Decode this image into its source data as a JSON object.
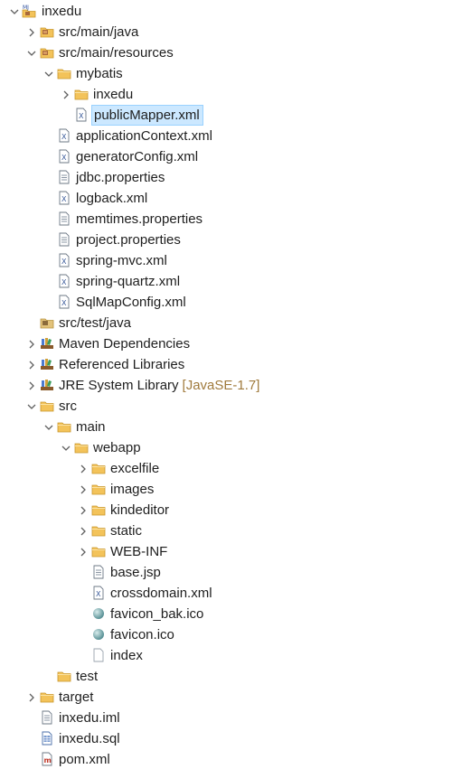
{
  "project_explorer": {
    "items": [
      {
        "label": "inxedu",
        "icon": "maven-project-icon",
        "state": "expanded",
        "level": 0
      },
      {
        "label": "src/main/java",
        "icon": "source-folder-icon",
        "state": "collapsed",
        "level": 1
      },
      {
        "label": "src/main/resources",
        "icon": "source-folder-icon",
        "state": "expanded",
        "level": 1
      },
      {
        "label": "mybatis",
        "icon": "folder-icon",
        "state": "expanded",
        "level": 2
      },
      {
        "label": "inxedu",
        "icon": "folder-icon",
        "state": "collapsed",
        "level": 3
      },
      {
        "label": "publicMapper.xml",
        "icon": "xml-file-icon",
        "state": "leaf",
        "level": 3,
        "selected": true
      },
      {
        "label": "applicationContext.xml",
        "icon": "xml-file-icon",
        "state": "leaf",
        "level": 2
      },
      {
        "label": "generatorConfig.xml",
        "icon": "xml-file-icon",
        "state": "leaf",
        "level": 2
      },
      {
        "label": "jdbc.properties",
        "icon": "text-file-icon",
        "state": "leaf",
        "level": 2
      },
      {
        "label": "logback.xml",
        "icon": "xml-file-icon",
        "state": "leaf",
        "level": 2
      },
      {
        "label": "memtimes.properties",
        "icon": "text-file-icon",
        "state": "leaf",
        "level": 2
      },
      {
        "label": "project.properties",
        "icon": "text-file-icon",
        "state": "leaf",
        "level": 2
      },
      {
        "label": "spring-mvc.xml",
        "icon": "xml-file-icon",
        "state": "leaf",
        "level": 2
      },
      {
        "label": "spring-quartz.xml",
        "icon": "xml-file-icon",
        "state": "leaf",
        "level": 2
      },
      {
        "label": "SqlMapConfig.xml",
        "icon": "xml-file-icon",
        "state": "leaf",
        "level": 2
      },
      {
        "label": "src/test/java",
        "icon": "source-folder-empty-icon",
        "state": "leaf",
        "level": 1
      },
      {
        "label": "Maven Dependencies",
        "icon": "library-icon",
        "state": "collapsed",
        "level": 1
      },
      {
        "label": "Referenced Libraries",
        "icon": "library-icon",
        "state": "collapsed",
        "level": 1
      },
      {
        "label": "JRE System Library",
        "decoration": "[JavaSE-1.7]",
        "icon": "library-icon",
        "state": "collapsed",
        "level": 1
      },
      {
        "label": "src",
        "icon": "folder-icon",
        "state": "expanded",
        "level": 1
      },
      {
        "label": "main",
        "icon": "folder-icon",
        "state": "expanded",
        "level": 2
      },
      {
        "label": "webapp",
        "icon": "folder-icon",
        "state": "expanded",
        "level": 3
      },
      {
        "label": "excelfile",
        "icon": "folder-icon",
        "state": "collapsed",
        "level": 4
      },
      {
        "label": "images",
        "icon": "folder-icon",
        "state": "collapsed",
        "level": 4
      },
      {
        "label": "kindeditor",
        "icon": "folder-icon",
        "state": "collapsed",
        "level": 4
      },
      {
        "label": "static",
        "icon": "folder-icon",
        "state": "collapsed",
        "level": 4
      },
      {
        "label": "WEB-INF",
        "icon": "folder-icon",
        "state": "collapsed",
        "level": 4
      },
      {
        "label": "base.jsp",
        "icon": "text-file-icon",
        "state": "leaf",
        "level": 4
      },
      {
        "label": "crossdomain.xml",
        "icon": "xml-file-icon",
        "state": "leaf",
        "level": 4
      },
      {
        "label": "favicon_bak.ico",
        "icon": "image-file-icon",
        "state": "leaf",
        "level": 4
      },
      {
        "label": "favicon.ico",
        "icon": "image-file-icon",
        "state": "leaf",
        "level": 4
      },
      {
        "label": "index",
        "icon": "plain-file-icon",
        "state": "leaf",
        "level": 4
      },
      {
        "label": "test",
        "icon": "folder-icon",
        "state": "leaf",
        "level": 2
      },
      {
        "label": "target",
        "icon": "folder-icon",
        "state": "collapsed",
        "level": 1
      },
      {
        "label": "inxedu.iml",
        "icon": "text-file-icon",
        "state": "leaf",
        "level": 1
      },
      {
        "label": "inxedu.sql",
        "icon": "sql-file-icon",
        "state": "leaf",
        "level": 1
      },
      {
        "label": "pom.xml",
        "icon": "maven-pom-icon",
        "state": "leaf",
        "level": 1
      }
    ]
  },
  "colors": {
    "selection_bg": "#cce8ff",
    "selection_border": "#99d1ff",
    "decoration_text": "#a07a3c",
    "folder": "#f3c35a",
    "chevron": "#606060"
  }
}
